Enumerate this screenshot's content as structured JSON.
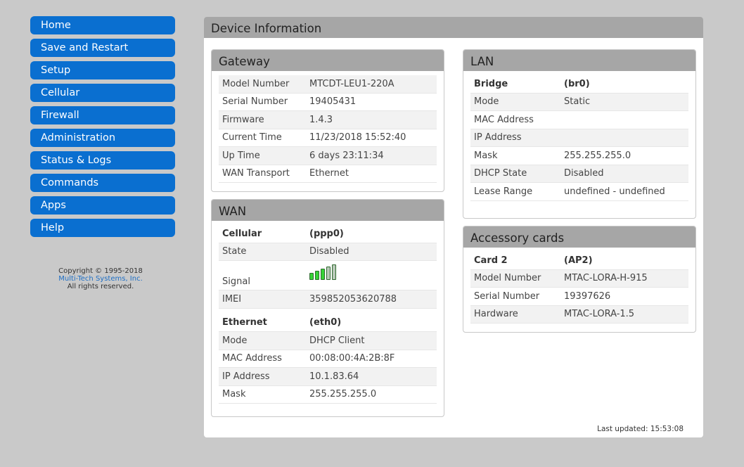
{
  "nav": {
    "items": [
      "Home",
      "Save and Restart",
      "Setup",
      "Cellular",
      "Firewall",
      "Administration",
      "Status & Logs",
      "Commands",
      "Apps",
      "Help"
    ]
  },
  "copyright": {
    "line1": "Copyright © 1995-2018",
    "company": "Multi-Tech Systems, Inc.",
    "rights": "All rights reserved."
  },
  "main": {
    "title": "Device Information",
    "last_updated": "Last updated: 15:53:08"
  },
  "gateway": {
    "title": "Gateway",
    "rows": [
      {
        "label": "Model Number",
        "value": "MTCDT-LEU1-220A"
      },
      {
        "label": "Serial Number",
        "value": "19405431"
      },
      {
        "label": "Firmware",
        "value": "1.4.3"
      },
      {
        "label": "Current Time",
        "value": "11/23/2018 15:52:40"
      },
      {
        "label": "Up Time",
        "value": "6 days 23:11:34"
      },
      {
        "label": "WAN Transport",
        "value": "Ethernet"
      }
    ]
  },
  "wan": {
    "title": "WAN",
    "cellular": {
      "label": "Cellular",
      "iface": "(ppp0)",
      "state_label": "State",
      "state": "Disabled",
      "signal_label": "Signal",
      "signal_bars": 5,
      "signal_active": 3,
      "signal_icon": "signal-strength-icon",
      "imei_label": "IMEI",
      "imei": "359852053620788"
    },
    "ethernet": {
      "label": "Ethernet",
      "iface": "(eth0)",
      "rows": [
        {
          "label": "Mode",
          "value": "DHCP Client"
        },
        {
          "label": "MAC Address",
          "value": "00:08:00:4A:2B:8F"
        },
        {
          "label": "IP Address",
          "value": "10.1.83.64"
        },
        {
          "label": "Mask",
          "value": "255.255.255.0"
        }
      ]
    }
  },
  "lan": {
    "title": "LAN",
    "bridge_label": "Bridge",
    "bridge_iface": "(br0)",
    "rows": [
      {
        "label": "Mode",
        "value": "Static"
      },
      {
        "label": "MAC Address",
        "value": ""
      },
      {
        "label": "IP Address",
        "value": ""
      },
      {
        "label": "Mask",
        "value": "255.255.255.0"
      },
      {
        "label": "DHCP State",
        "value": "Disabled"
      },
      {
        "label": "Lease Range",
        "value": "undefined - undefined"
      }
    ]
  },
  "accessory": {
    "title": "Accessory cards",
    "card_label": "Card 2",
    "card_id": "(AP2)",
    "rows": [
      {
        "label": "Model Number",
        "value": "MTAC-LORA-H-915"
      },
      {
        "label": "Serial Number",
        "value": "19397626"
      },
      {
        "label": "Hardware",
        "value": "MTAC-LORA-1.5"
      }
    ]
  },
  "colors": {
    "nav_button": "#0a6fd0",
    "header_bar": "#a6a6a6",
    "background": "#c9c9c9",
    "signal_on": "#37d337"
  }
}
